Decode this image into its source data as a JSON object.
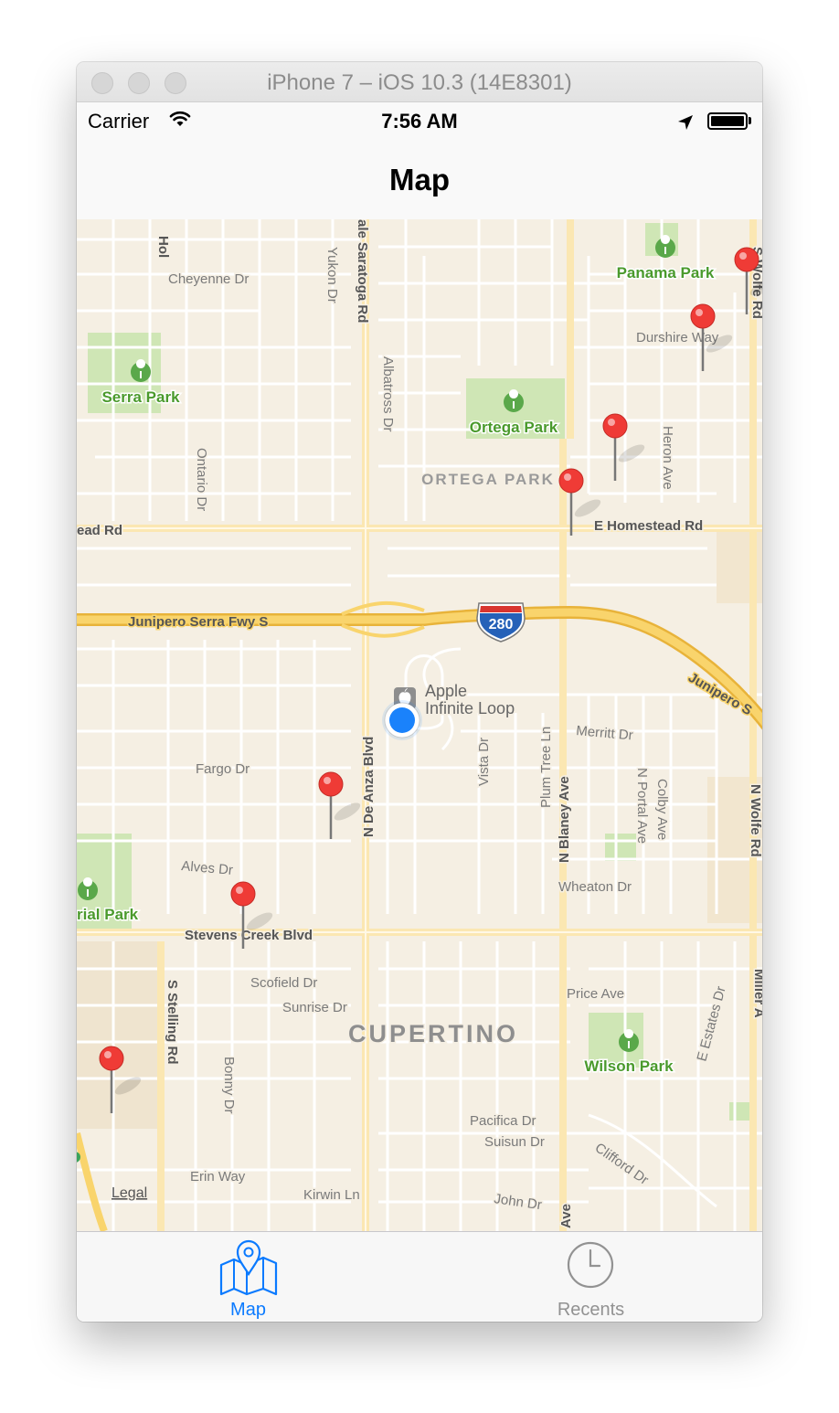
{
  "window": {
    "title": "iPhone 7 – iOS 10.3 (14E8301)"
  },
  "status_bar": {
    "carrier": "Carrier",
    "time": "7:56 AM"
  },
  "nav": {
    "title": "Map"
  },
  "map": {
    "parks": [
      "Panama Park",
      "Serra Park",
      "Ortega Park",
      "rial Park",
      "Wilson Park"
    ],
    "streets": {
      "hol": "Hol",
      "cheyenne": "Cheyenne Dr",
      "saratoga": "ale Saratoga Rd",
      "yukon": "Yukon Dr",
      "wolfe_top": "S Wolfe Rd",
      "durshire": "Durshire Way",
      "albatross": "Albatross Dr",
      "ontario": "Ontario Dr",
      "heron": "Heron Ave",
      "homestead_w": "ead Rd",
      "homestead_e": "E Homestead Rd",
      "junipero_w": "Junipero Serra Fwy S",
      "junipero_e": "Junipero S",
      "merritt": "Merritt Dr",
      "fargo": "Fargo Dr",
      "de_anza": "N De Anza Blvd",
      "vista": "Vista Dr",
      "plum_tree": "Plum Tree Ln",
      "blaney": "N Blaney Ave",
      "portal": "N Portal Ave",
      "colby": "Colby Ave",
      "wolfe": "N Wolfe Rd",
      "alves": "Alves Dr",
      "wheaton": "Wheaton Dr",
      "stevens_creek": "Stevens Creek Blvd",
      "scofield": "Scofield Dr",
      "sunrise": "Sunrise Dr",
      "price": "Price Ave",
      "e_estates": "E Estates Dr",
      "miller": "Miller A",
      "stelling": "S Stelling Rd",
      "bonny": "Bonny Dr",
      "pacifica": "Pacifica Dr",
      "suisun": "Suisun Dr",
      "clifford": "Clifford Dr",
      "erin": "Erin Way",
      "kirwin": "Kirwin Ln",
      "john": "John Dr",
      "ave_bottom": "Ave"
    },
    "highway_shield": "280",
    "neighborhood": "ORTEGA PARK",
    "city": "CUPERTINO",
    "poi": {
      "line1": "Apple",
      "line2": "Infinite Loop"
    },
    "legal": "Legal",
    "pin_color": "#ef3b36",
    "user_location_color": "#1a82fb"
  },
  "tabs": [
    {
      "label": "Map",
      "icon": "map-pin-icon",
      "selected": true
    },
    {
      "label": "Recents",
      "icon": "clock-icon",
      "selected": false
    }
  ],
  "accent_color": "#0a7aff"
}
